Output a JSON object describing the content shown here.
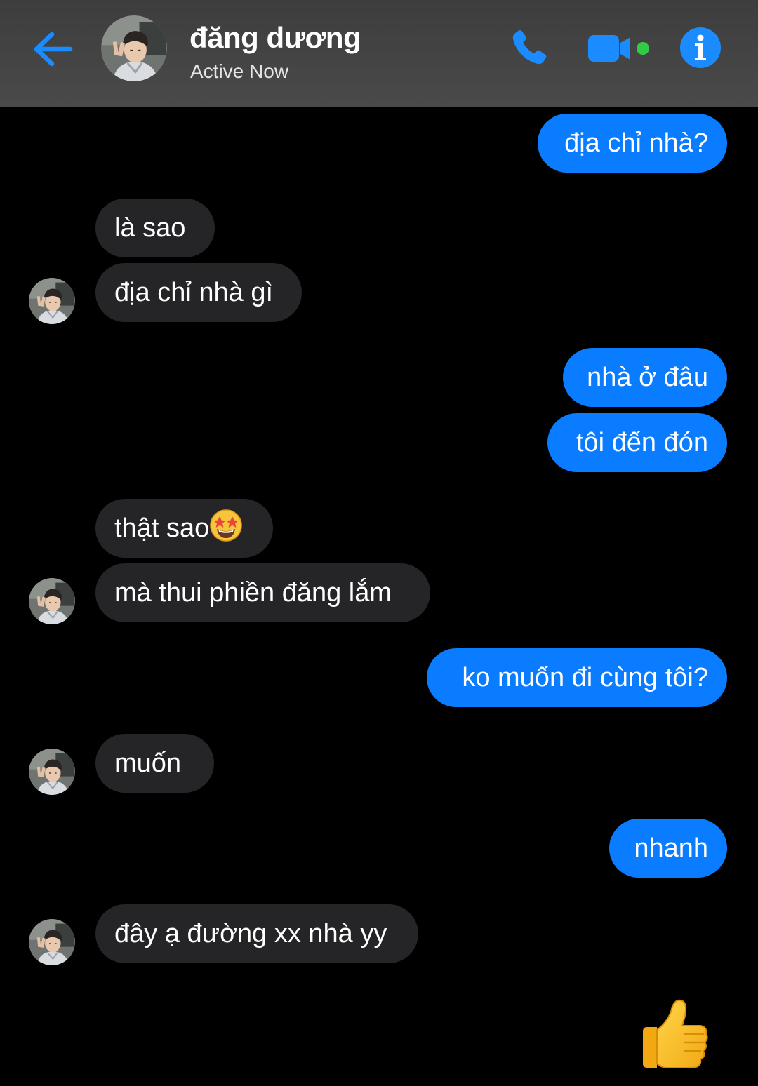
{
  "header": {
    "name": "đăng dương",
    "status": "Active Now"
  },
  "colors": {
    "accent": "#0a7cff",
    "incoming_bubble": "#252527",
    "header_bg": "#444444",
    "active_dot": "#31cc46"
  },
  "icons": {
    "back": "arrow-left-icon",
    "call": "phone-icon",
    "video": "video-camera-icon",
    "info": "info-icon",
    "like": "thumbs-up-icon"
  },
  "messages": [
    {
      "side": "out",
      "text": "địa chỉ nhà?"
    },
    {
      "side": "in",
      "text": "là sao"
    },
    {
      "side": "in",
      "text": "địa chỉ nhà gì"
    },
    {
      "side": "out",
      "text": "nhà ở đâu"
    },
    {
      "side": "out",
      "text": "tôi đến đón"
    },
    {
      "side": "in",
      "text": "thật sao",
      "emoji": "star-struck"
    },
    {
      "side": "in",
      "text": "mà thui phiền đăng lắm"
    },
    {
      "side": "out",
      "text": "ko muốn đi cùng tôi?"
    },
    {
      "side": "in",
      "text": "muốn"
    },
    {
      "side": "out",
      "text": "nhanh"
    },
    {
      "side": "in",
      "text": "đây ạ đường xx nhà yy"
    }
  ]
}
